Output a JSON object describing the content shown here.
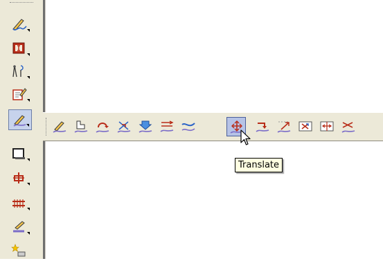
{
  "vertical_toolbar": {
    "tools": [
      {
        "icon": "sketch-curve-icon",
        "has_flyout": true
      },
      {
        "icon": "i-beam-icon",
        "has_flyout": true
      },
      {
        "icon": "compass-measure-icon",
        "has_flyout": true
      },
      {
        "icon": "edit-document-icon",
        "has_flyout": true
      },
      {
        "icon": "curve-tools-icon",
        "has_flyout": true,
        "active": true
      },
      {
        "icon": "rectangle-icon",
        "has_flyout": true
      },
      {
        "icon": "pipe-section-icon",
        "has_flyout": true
      },
      {
        "icon": "rail-track-icon",
        "has_flyout": true
      },
      {
        "icon": "ruler-pencil-icon",
        "has_flyout": true
      },
      {
        "icon": "star-tool-icon",
        "has_flyout": true
      }
    ]
  },
  "flyout_toolbar": {
    "tools": [
      {
        "icon": "draw-curve-icon"
      },
      {
        "icon": "curve-to-shape-icon"
      },
      {
        "icon": "rotate-curve-icon"
      },
      {
        "icon": "cross-curve-icon"
      },
      {
        "icon": "project-down-icon"
      },
      {
        "icon": "parallel-curve-icon"
      },
      {
        "icon": "blend-curve-icon"
      },
      {
        "icon": "translate-icon",
        "pressed": true
      },
      {
        "icon": "move-arrow-icon"
      },
      {
        "icon": "extend-curve-icon"
      },
      {
        "icon": "scale-box-icon"
      },
      {
        "icon": "mirror-box-icon"
      },
      {
        "icon": "split-curve-icon"
      }
    ]
  },
  "tooltip": {
    "text": "Translate"
  },
  "colors": {
    "toolbar_bg": "#ece9d8",
    "active_bg": "#b6c3e6",
    "tooltip_bg": "#ffffe1"
  }
}
